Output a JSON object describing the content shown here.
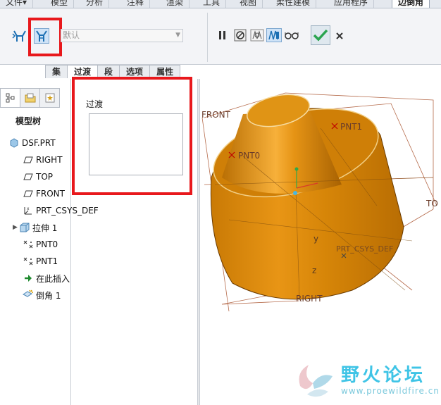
{
  "ribbon": {
    "tabs": [
      "文件▾",
      "模型",
      "分析",
      "注释",
      "渲染",
      "工具",
      "视图",
      "柔性建模",
      "应用程序",
      "边倒角"
    ],
    "active_tab": "边倒角"
  },
  "toolbar": {
    "dropdown_value": "默认",
    "icons": [
      "set-mode-icon",
      "transition-mode-icon",
      "pause-icon",
      "no-preview-icon",
      "separate-preview-icon",
      "verify-preview-icon",
      "glasses-icon",
      "apply-check-icon",
      "cancel-x-icon"
    ]
  },
  "subtabs": [
    "集",
    "过渡",
    "段",
    "选项",
    "属性"
  ],
  "active_subtab": "过渡",
  "transition_panel": {
    "label": "过渡"
  },
  "model_tree": {
    "title": "模型树",
    "items": [
      {
        "label": "DSF.PRT",
        "icon": "part-icon"
      },
      {
        "label": "RIGHT",
        "icon": "datum-plane-icon"
      },
      {
        "label": "TOP",
        "icon": "datum-plane-icon"
      },
      {
        "label": "FRONT",
        "icon": "datum-plane-icon"
      },
      {
        "label": "PRT_CSYS_DEF",
        "icon": "csys-icon"
      },
      {
        "label": "拉伸 1",
        "icon": "extrude-icon"
      },
      {
        "label": "PNT0",
        "icon": "datum-point-icon"
      },
      {
        "label": "PNT1",
        "icon": "datum-point-icon"
      },
      {
        "label": "在此插入",
        "icon": "insert-arrow-icon"
      },
      {
        "label": "倒角 1",
        "icon": "chamfer-icon"
      }
    ]
  },
  "viewport": {
    "labels": {
      "front": "FRONT",
      "top": "TO",
      "right": "RIGHT",
      "pnt0": "PNT0",
      "pnt1": "PNT1",
      "csys": "PRT_CSYS_DEF",
      "axis_y": "y",
      "axis_z": "z",
      "axis_x": "x"
    },
    "model_color": "#d98a0c"
  },
  "watermark": {
    "cn": "野火论坛",
    "en": "www.proewildfire.cn"
  }
}
